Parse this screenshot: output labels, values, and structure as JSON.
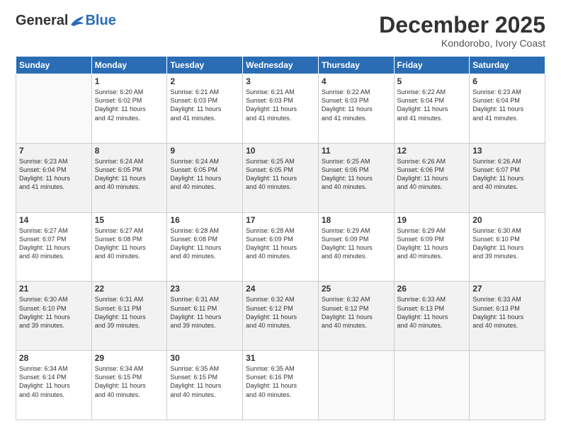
{
  "logo": {
    "general": "General",
    "blue": "Blue"
  },
  "header": {
    "month": "December 2025",
    "location": "Kondorobo, Ivory Coast"
  },
  "days_of_week": [
    "Sunday",
    "Monday",
    "Tuesday",
    "Wednesday",
    "Thursday",
    "Friday",
    "Saturday"
  ],
  "weeks": [
    [
      {
        "day": "",
        "info": ""
      },
      {
        "day": "1",
        "info": "Sunrise: 6:20 AM\nSunset: 6:02 PM\nDaylight: 11 hours\nand 42 minutes."
      },
      {
        "day": "2",
        "info": "Sunrise: 6:21 AM\nSunset: 6:03 PM\nDaylight: 11 hours\nand 41 minutes."
      },
      {
        "day": "3",
        "info": "Sunrise: 6:21 AM\nSunset: 6:03 PM\nDaylight: 11 hours\nand 41 minutes."
      },
      {
        "day": "4",
        "info": "Sunrise: 6:22 AM\nSunset: 6:03 PM\nDaylight: 11 hours\nand 41 minutes."
      },
      {
        "day": "5",
        "info": "Sunrise: 6:22 AM\nSunset: 6:04 PM\nDaylight: 11 hours\nand 41 minutes."
      },
      {
        "day": "6",
        "info": "Sunrise: 6:23 AM\nSunset: 6:04 PM\nDaylight: 11 hours\nand 41 minutes."
      }
    ],
    [
      {
        "day": "7",
        "info": "Sunrise: 6:23 AM\nSunset: 6:04 PM\nDaylight: 11 hours\nand 41 minutes."
      },
      {
        "day": "8",
        "info": "Sunrise: 6:24 AM\nSunset: 6:05 PM\nDaylight: 11 hours\nand 40 minutes."
      },
      {
        "day": "9",
        "info": "Sunrise: 6:24 AM\nSunset: 6:05 PM\nDaylight: 11 hours\nand 40 minutes."
      },
      {
        "day": "10",
        "info": "Sunrise: 6:25 AM\nSunset: 6:05 PM\nDaylight: 11 hours\nand 40 minutes."
      },
      {
        "day": "11",
        "info": "Sunrise: 6:25 AM\nSunset: 6:06 PM\nDaylight: 11 hours\nand 40 minutes."
      },
      {
        "day": "12",
        "info": "Sunrise: 6:26 AM\nSunset: 6:06 PM\nDaylight: 11 hours\nand 40 minutes."
      },
      {
        "day": "13",
        "info": "Sunrise: 6:26 AM\nSunset: 6:07 PM\nDaylight: 11 hours\nand 40 minutes."
      }
    ],
    [
      {
        "day": "14",
        "info": "Sunrise: 6:27 AM\nSunset: 6:07 PM\nDaylight: 11 hours\nand 40 minutes."
      },
      {
        "day": "15",
        "info": "Sunrise: 6:27 AM\nSunset: 6:08 PM\nDaylight: 11 hours\nand 40 minutes."
      },
      {
        "day": "16",
        "info": "Sunrise: 6:28 AM\nSunset: 6:08 PM\nDaylight: 11 hours\nand 40 minutes."
      },
      {
        "day": "17",
        "info": "Sunrise: 6:28 AM\nSunset: 6:09 PM\nDaylight: 11 hours\nand 40 minutes."
      },
      {
        "day": "18",
        "info": "Sunrise: 6:29 AM\nSunset: 6:09 PM\nDaylight: 11 hours\nand 40 minutes."
      },
      {
        "day": "19",
        "info": "Sunrise: 6:29 AM\nSunset: 6:09 PM\nDaylight: 11 hours\nand 40 minutes."
      },
      {
        "day": "20",
        "info": "Sunrise: 6:30 AM\nSunset: 6:10 PM\nDaylight: 11 hours\nand 39 minutes."
      }
    ],
    [
      {
        "day": "21",
        "info": "Sunrise: 6:30 AM\nSunset: 6:10 PM\nDaylight: 11 hours\nand 39 minutes."
      },
      {
        "day": "22",
        "info": "Sunrise: 6:31 AM\nSunset: 6:11 PM\nDaylight: 11 hours\nand 39 minutes."
      },
      {
        "day": "23",
        "info": "Sunrise: 6:31 AM\nSunset: 6:11 PM\nDaylight: 11 hours\nand 39 minutes."
      },
      {
        "day": "24",
        "info": "Sunrise: 6:32 AM\nSunset: 6:12 PM\nDaylight: 11 hours\nand 40 minutes."
      },
      {
        "day": "25",
        "info": "Sunrise: 6:32 AM\nSunset: 6:12 PM\nDaylight: 11 hours\nand 40 minutes."
      },
      {
        "day": "26",
        "info": "Sunrise: 6:33 AM\nSunset: 6:13 PM\nDaylight: 11 hours\nand 40 minutes."
      },
      {
        "day": "27",
        "info": "Sunrise: 6:33 AM\nSunset: 6:13 PM\nDaylight: 11 hours\nand 40 minutes."
      }
    ],
    [
      {
        "day": "28",
        "info": "Sunrise: 6:34 AM\nSunset: 6:14 PM\nDaylight: 11 hours\nand 40 minutes."
      },
      {
        "day": "29",
        "info": "Sunrise: 6:34 AM\nSunset: 6:15 PM\nDaylight: 11 hours\nand 40 minutes."
      },
      {
        "day": "30",
        "info": "Sunrise: 6:35 AM\nSunset: 6:15 PM\nDaylight: 11 hours\nand 40 minutes."
      },
      {
        "day": "31",
        "info": "Sunrise: 6:35 AM\nSunset: 6:16 PM\nDaylight: 11 hours\nand 40 minutes."
      },
      {
        "day": "",
        "info": ""
      },
      {
        "day": "",
        "info": ""
      },
      {
        "day": "",
        "info": ""
      }
    ]
  ]
}
